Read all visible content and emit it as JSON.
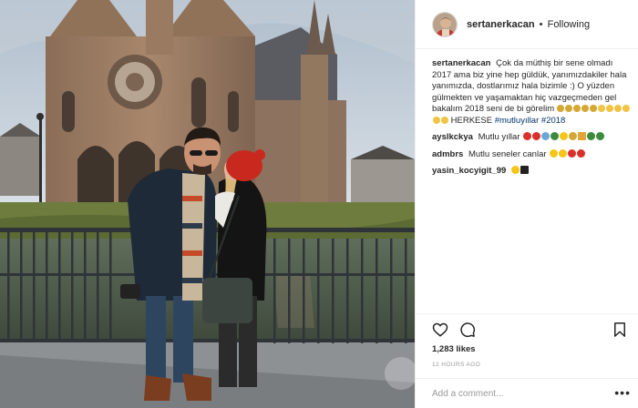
{
  "post": {
    "author": "sertanerkacan",
    "separator": "•",
    "follow_status": "Following"
  },
  "caption": {
    "user": "sertanerkacan",
    "text": "Çok da müthiş bir sene olmadı 2017 ama biz yine hep güldük, yanımızdakiler hala yanımızda, dostlarımız hala bizimle :) O yüzden gülmekten ve yaşamaktan hiç vazgeçmeden gel bakalım 2018 seni de bi görelim",
    "text_after_emoji": "HERKESE",
    "hashtags": [
      "#mutluyıllar",
      "#2018"
    ]
  },
  "comments": [
    {
      "user": "ayslkckya",
      "text": "Mutlu yıllar"
    },
    {
      "user": "admbrs",
      "text": "Mutlu seneler canlar"
    },
    {
      "user": "yasin_kocyigit_99",
      "text": ""
    }
  ],
  "icons": [
    "heart-icon",
    "comment-icon",
    "bookmark-icon",
    "more-options-icon"
  ],
  "likes": "1,283 likes",
  "timestamp": "12 HOURS AGO",
  "add_comment": {
    "placeholder": "Add a comment..."
  },
  "more_options": "•••",
  "colors": {
    "text": "#262626",
    "secondary": "#999999",
    "border": "#efefef",
    "hashtag": "#003569",
    "emoji_yellow": "#f5c518",
    "emoji_red": "#d9302c"
  }
}
